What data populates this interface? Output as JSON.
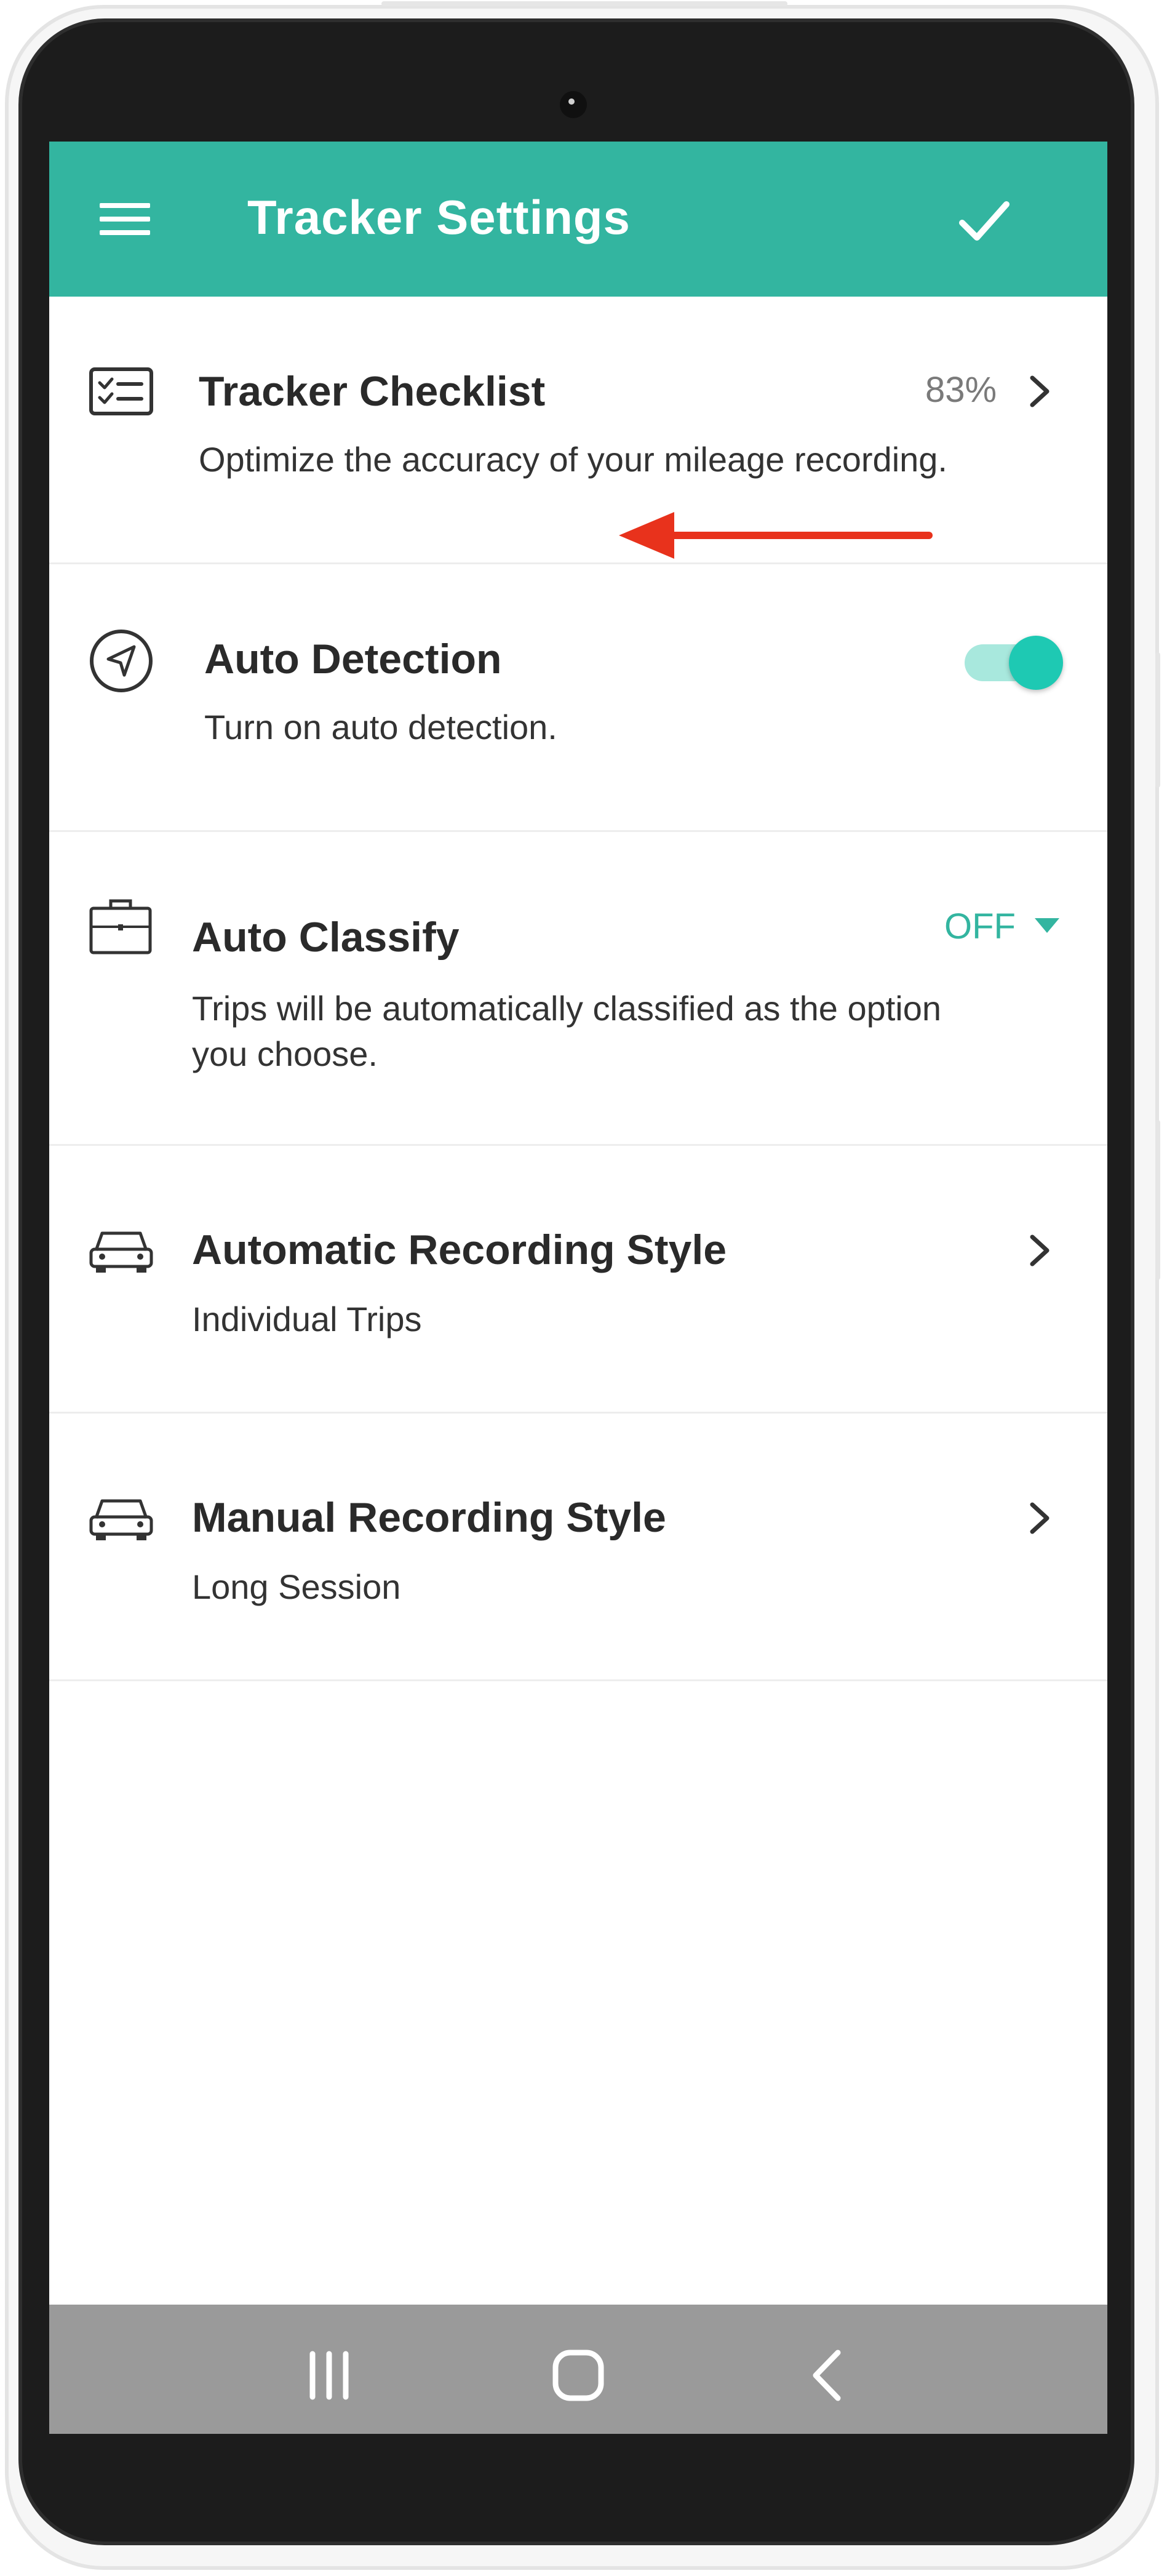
{
  "appbar": {
    "title": "Tracker Settings",
    "menu_icon": "hamburger-menu-icon",
    "confirm_icon": "checkmark-icon",
    "color": "#33b5a0"
  },
  "settings": [
    {
      "id": "tracker-checklist",
      "icon": "checklist-icon",
      "title": "Tracker Checklist",
      "subtitle": "Optimize the accuracy of your mileage recording.",
      "value": "83%",
      "control": "chevron"
    },
    {
      "id": "auto-detection",
      "icon": "compass-navigation-icon",
      "title": "Auto Detection",
      "subtitle": "Turn on auto detection.",
      "control": "toggle",
      "toggle_on": true
    },
    {
      "id": "auto-classify",
      "icon": "briefcase-icon",
      "title": "Auto Classify",
      "subtitle_lines": [
        "Trips will be automatically classified as the option",
        "you choose."
      ],
      "value": "OFF",
      "control": "dropdown"
    },
    {
      "id": "automatic-recording-style",
      "icon": "car-icon",
      "title": "Automatic Recording Style",
      "subtitle": "Individual Trips",
      "control": "chevron"
    },
    {
      "id": "manual-recording-style",
      "icon": "car-icon",
      "title": "Manual Recording Style",
      "subtitle": "Long Session",
      "control": "chevron"
    }
  ],
  "annotation": {
    "arrow_color": "#e8321c"
  },
  "navbar": {
    "icons": [
      "recent-apps-icon",
      "home-icon",
      "back-icon"
    ],
    "color": "#9a9a9a"
  }
}
